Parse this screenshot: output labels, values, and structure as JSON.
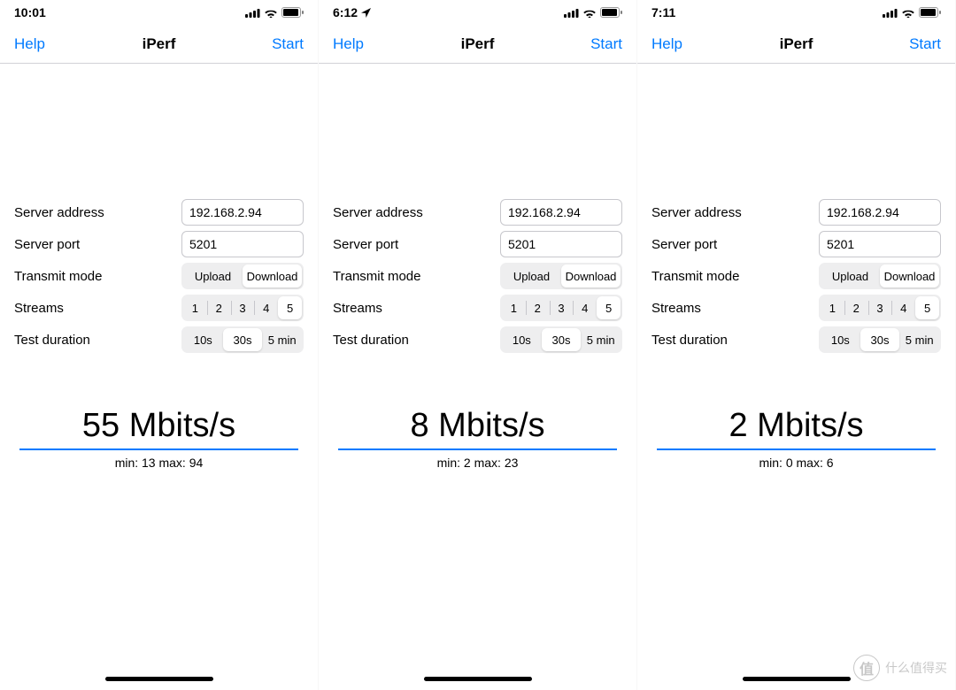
{
  "watermark_text": "什么值得买",
  "watermark_badge": "值",
  "screens": [
    {
      "status": {
        "time": "10:01",
        "location_icon": false
      },
      "nav": {
        "help": "Help",
        "title": "iPerf",
        "start": "Start"
      },
      "form": {
        "server_address_label": "Server address",
        "server_address_value": "192.168.2.94",
        "server_port_label": "Server port",
        "server_port_value": "5201",
        "transmit_mode_label": "Transmit mode",
        "mode_options": [
          "Upload",
          "Download"
        ],
        "mode_selected": 1,
        "streams_label": "Streams",
        "streams_options": [
          "1",
          "2",
          "3",
          "4",
          "5"
        ],
        "streams_selected": 4,
        "duration_label": "Test duration",
        "duration_options": [
          "10s",
          "30s",
          "5 min"
        ],
        "duration_selected": 1
      },
      "result": {
        "headline": "55 Mbits/s",
        "sub": "min: 13 max: 94"
      }
    },
    {
      "status": {
        "time": "6:12",
        "location_icon": true
      },
      "nav": {
        "help": "Help",
        "title": "iPerf",
        "start": "Start"
      },
      "form": {
        "server_address_label": "Server address",
        "server_address_value": "192.168.2.94",
        "server_port_label": "Server port",
        "server_port_value": "5201",
        "transmit_mode_label": "Transmit mode",
        "mode_options": [
          "Upload",
          "Download"
        ],
        "mode_selected": 1,
        "streams_label": "Streams",
        "streams_options": [
          "1",
          "2",
          "3",
          "4",
          "5"
        ],
        "streams_selected": 4,
        "duration_label": "Test duration",
        "duration_options": [
          "10s",
          "30s",
          "5 min"
        ],
        "duration_selected": 1
      },
      "result": {
        "headline": "8 Mbits/s",
        "sub": "min: 2 max: 23"
      }
    },
    {
      "status": {
        "time": "7:11",
        "location_icon": false
      },
      "nav": {
        "help": "Help",
        "title": "iPerf",
        "start": "Start"
      },
      "form": {
        "server_address_label": "Server address",
        "server_address_value": "192.168.2.94",
        "server_port_label": "Server port",
        "server_port_value": "5201",
        "transmit_mode_label": "Transmit mode",
        "mode_options": [
          "Upload",
          "Download"
        ],
        "mode_selected": 1,
        "streams_label": "Streams",
        "streams_options": [
          "1",
          "2",
          "3",
          "4",
          "5"
        ],
        "streams_selected": 4,
        "duration_label": "Test duration",
        "duration_options": [
          "10s",
          "30s",
          "5 min"
        ],
        "duration_selected": 1
      },
      "result": {
        "headline": "2 Mbits/s",
        "sub": "min: 0 max: 6"
      }
    }
  ]
}
